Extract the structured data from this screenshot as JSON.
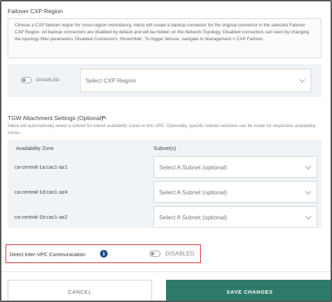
{
  "failover": {
    "title": "Failover CXP Region",
    "description": "Choose a CXP failover region for cross-region redundancy. Alkira will create a backup connector for the original connector in the selected Failover CXP Region. All backup connectors are disabled by default and will be hidden on the Network Topology. Disabled connectors can seen by changing the topology filter parameters 'Disabled Connectors: Show/Hide'. To trigger failover, navigate to Management > CXP Failover.",
    "toggle_label": "DISABLED",
    "region_placeholder": "Select CXP Region"
  },
  "tgw": {
    "title": "TGW Attachment Settings (Optional)",
    "description": "Alkira will automatically select a subnet for linked availability zones in this VPC. Optionally, specific subnet selection can be made for respective availability zones.",
    "columns": [
      "Availability Zone",
      "Subnet(s)"
    ],
    "rows": [
      {
        "zone": "ca-central-1a:cac1-az1",
        "subnet": "Select A Subnet (optional)"
      },
      {
        "zone": "ca-central-1d:cac1-az4",
        "subnet": "Select A Subnet (optional)"
      },
      {
        "zone": "ca-central-1b:cac1-az2",
        "subnet": "Select A Subnet (optional)"
      }
    ]
  },
  "direct_inter_vpc": {
    "label": "Direct Inter-VPC Communication",
    "info_glyph": "i",
    "toggle_label": "DISABLED"
  },
  "footer": {
    "cancel_label": "CANCEL",
    "save_label": "SAVE CHANGES"
  },
  "colors": {
    "save_button": "#2e7b6a",
    "highlight_border": "#d32f2f",
    "info_icon": "#1f4e8c"
  }
}
